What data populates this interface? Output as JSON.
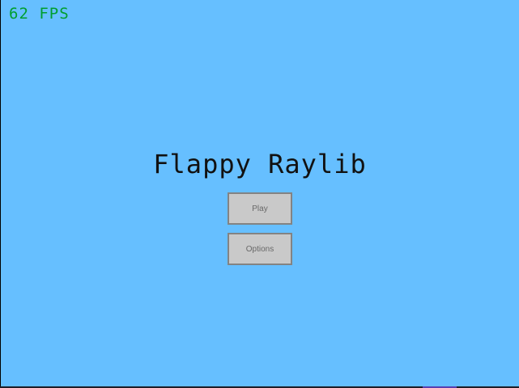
{
  "hud": {
    "fps_text": "62 FPS"
  },
  "menu": {
    "title": "Flappy Raylib",
    "play_label": "Play",
    "options_label": "Options"
  },
  "colors": {
    "sky": "#66bfff",
    "fps_text": "#009e2f",
    "title_text": "#111111",
    "button_bg": "#c9c9c9",
    "button_border": "#838383",
    "button_text": "#686868"
  }
}
